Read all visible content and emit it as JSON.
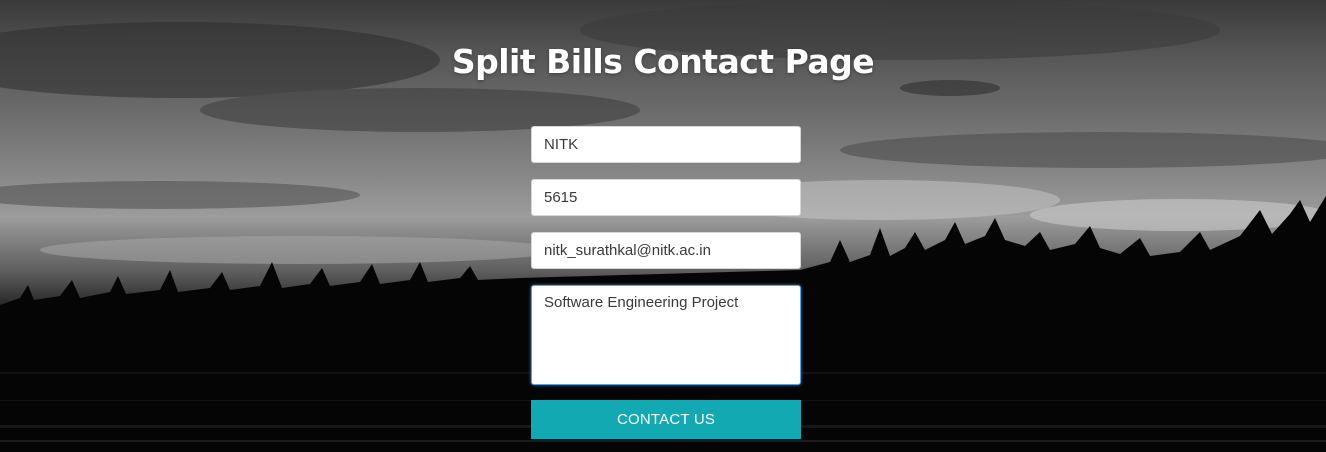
{
  "header": {
    "title": "Split Bills Contact Page"
  },
  "form": {
    "name_value": "NITK",
    "phone_value": "5615",
    "email_value": "nitk_surathkal@nitk.ac.in",
    "message_value": "Software Engineering Project",
    "submit_label": "CONTACT US"
  },
  "colors": {
    "button_bg": "#12a9b2",
    "focus_border": "#5d9fd6"
  }
}
